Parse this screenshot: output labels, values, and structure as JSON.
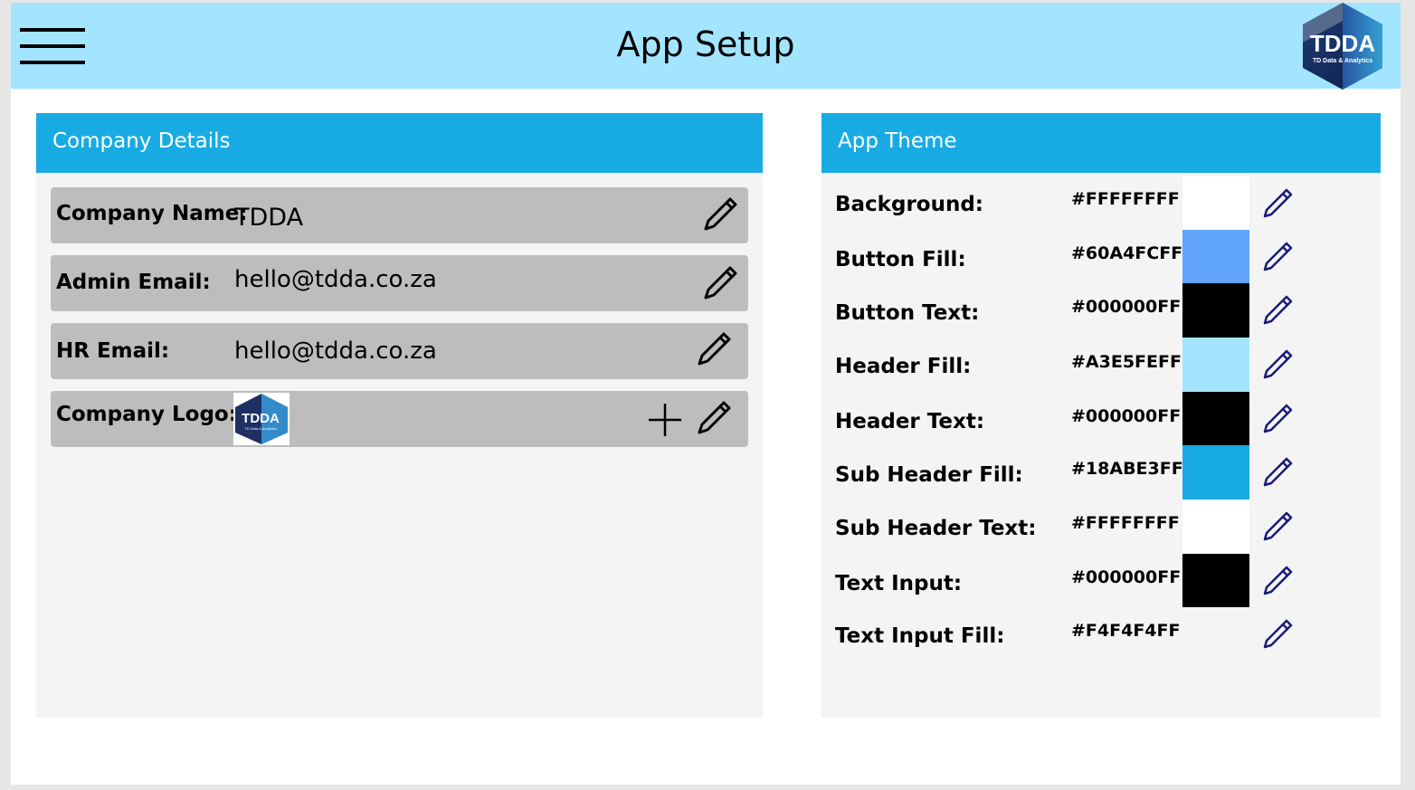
{
  "header": {
    "title": "App Setup",
    "logo_text": "TDDA",
    "logo_subtext": "TD Data & Analytics",
    "menu_icon": "hamburger-menu-icon"
  },
  "company_details": {
    "title": "Company Details",
    "rows": [
      {
        "label": "Company Name:",
        "value": "TDDA"
      },
      {
        "label": "Admin Email:",
        "value": "hello@tdda.co.za"
      },
      {
        "label": "HR Email:",
        "value": "hello@tdda.co.za"
      },
      {
        "label": "Company Logo:",
        "value": ""
      }
    ]
  },
  "app_theme": {
    "title": "App Theme",
    "rows": [
      {
        "label": "Background:",
        "hex": "#FFFFFFFF",
        "color": "#FFFFFF"
      },
      {
        "label": "Button Fill:",
        "hex": "#60A4FCFF",
        "color": "#60A4FC"
      },
      {
        "label": "Button Text:",
        "hex": "#000000FF",
        "color": "#000000"
      },
      {
        "label": "Header Fill:",
        "hex": "#A3E5FEFF",
        "color": "#A3E5FE"
      },
      {
        "label": "Header Text:",
        "hex": "#000000FF",
        "color": "#000000"
      },
      {
        "label": "Sub Header Fill:",
        "hex": "#18ABE3FF",
        "color": "#18ABE3"
      },
      {
        "label": "Sub Header Text:",
        "hex": "#FFFFFFFF",
        "color": "#FFFFFF"
      },
      {
        "label": "Text Input:",
        "hex": "#000000FF",
        "color": "#000000"
      },
      {
        "label": "Text Input Fill:",
        "hex": "#F4F4F4FF",
        "color": "#F4F4F4"
      }
    ]
  },
  "colors": {
    "header_fill": "#A3E5FE",
    "sub_header_fill": "#18ABE3",
    "panel_fill": "#F4F4F4",
    "row_fill": "#BDBDBD",
    "theme_edit_icon": "#1A1A7A"
  }
}
